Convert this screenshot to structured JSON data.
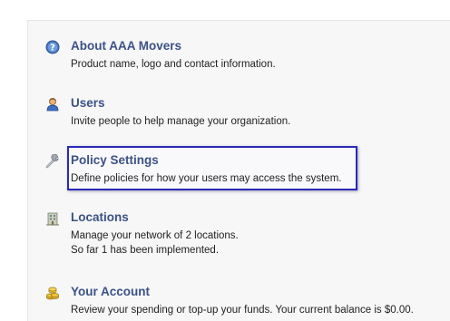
{
  "items": [
    {
      "id": "about",
      "icon": "help-icon",
      "title": "About AAA Movers",
      "lines": [
        "Product name, logo and contact information."
      ]
    },
    {
      "id": "users",
      "icon": "user-icon",
      "title": "Users",
      "lines": [
        "Invite people to help manage your organization."
      ]
    },
    {
      "id": "policy",
      "icon": "wrench-icon",
      "title": "Policy Settings",
      "lines": [
        "Define policies for how your users may access the system."
      ],
      "highlighted": true
    },
    {
      "id": "locations",
      "icon": "building-icon",
      "title": "Locations",
      "lines": [
        "Manage your network of 2 locations.",
        "So far 1 has been implemented."
      ]
    },
    {
      "id": "account",
      "icon": "coins-icon",
      "title": "Your Account",
      "lines": [
        "Review your spending or top-up your funds. Your current balance is $0.00."
      ]
    }
  ],
  "colors": {
    "title": "#3b5286",
    "highlight_border": "#2a2ab8"
  }
}
